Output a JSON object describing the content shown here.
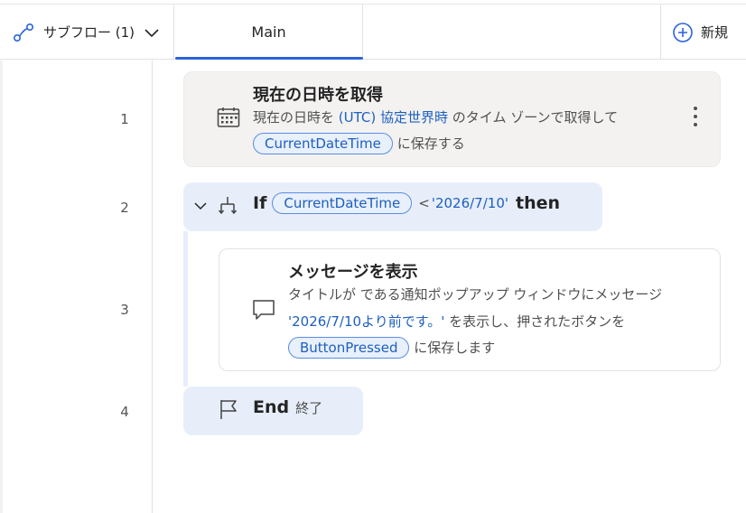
{
  "tabs": {
    "subflow_label": "サブフロー (1)",
    "main_label": "Main",
    "new_label": "新規"
  },
  "colors": {
    "accent": "#2b64d8",
    "variable": "#1d5fbf",
    "if_block": "#e7eefa",
    "card_gray": "#f3f2f1"
  },
  "actions": [
    {
      "line": "1",
      "icon": "calendar-icon",
      "title": "現在の日時を取得",
      "desc_prefix": "現在の日時を",
      "desc_value": "(UTC) 協定世界時",
      "desc_suffix": "のタイム ゾーンで取得して",
      "variable": "CurrentDateTime",
      "desc_end": "に保存する"
    },
    {
      "line": "2",
      "icon": "if-branch-icon",
      "keyword": "If",
      "variable": "CurrentDateTime",
      "operator": "<",
      "value": "'2026/7/10'",
      "keyword_end": "then"
    },
    {
      "line": "3",
      "icon": "message-icon",
      "title": "メッセージを表示",
      "desc_line1": "タイトルが  である通知ポップアップ ウィンドウにメッセージ",
      "desc_value": "'2026/7/10より前です。'",
      "desc_line2": "を表示し、押されたボタンを",
      "variable": "ButtonPressed",
      "desc_end": "に保存します"
    },
    {
      "line": "4",
      "icon": "flag-icon",
      "keyword": "End",
      "sub": "終了"
    }
  ]
}
